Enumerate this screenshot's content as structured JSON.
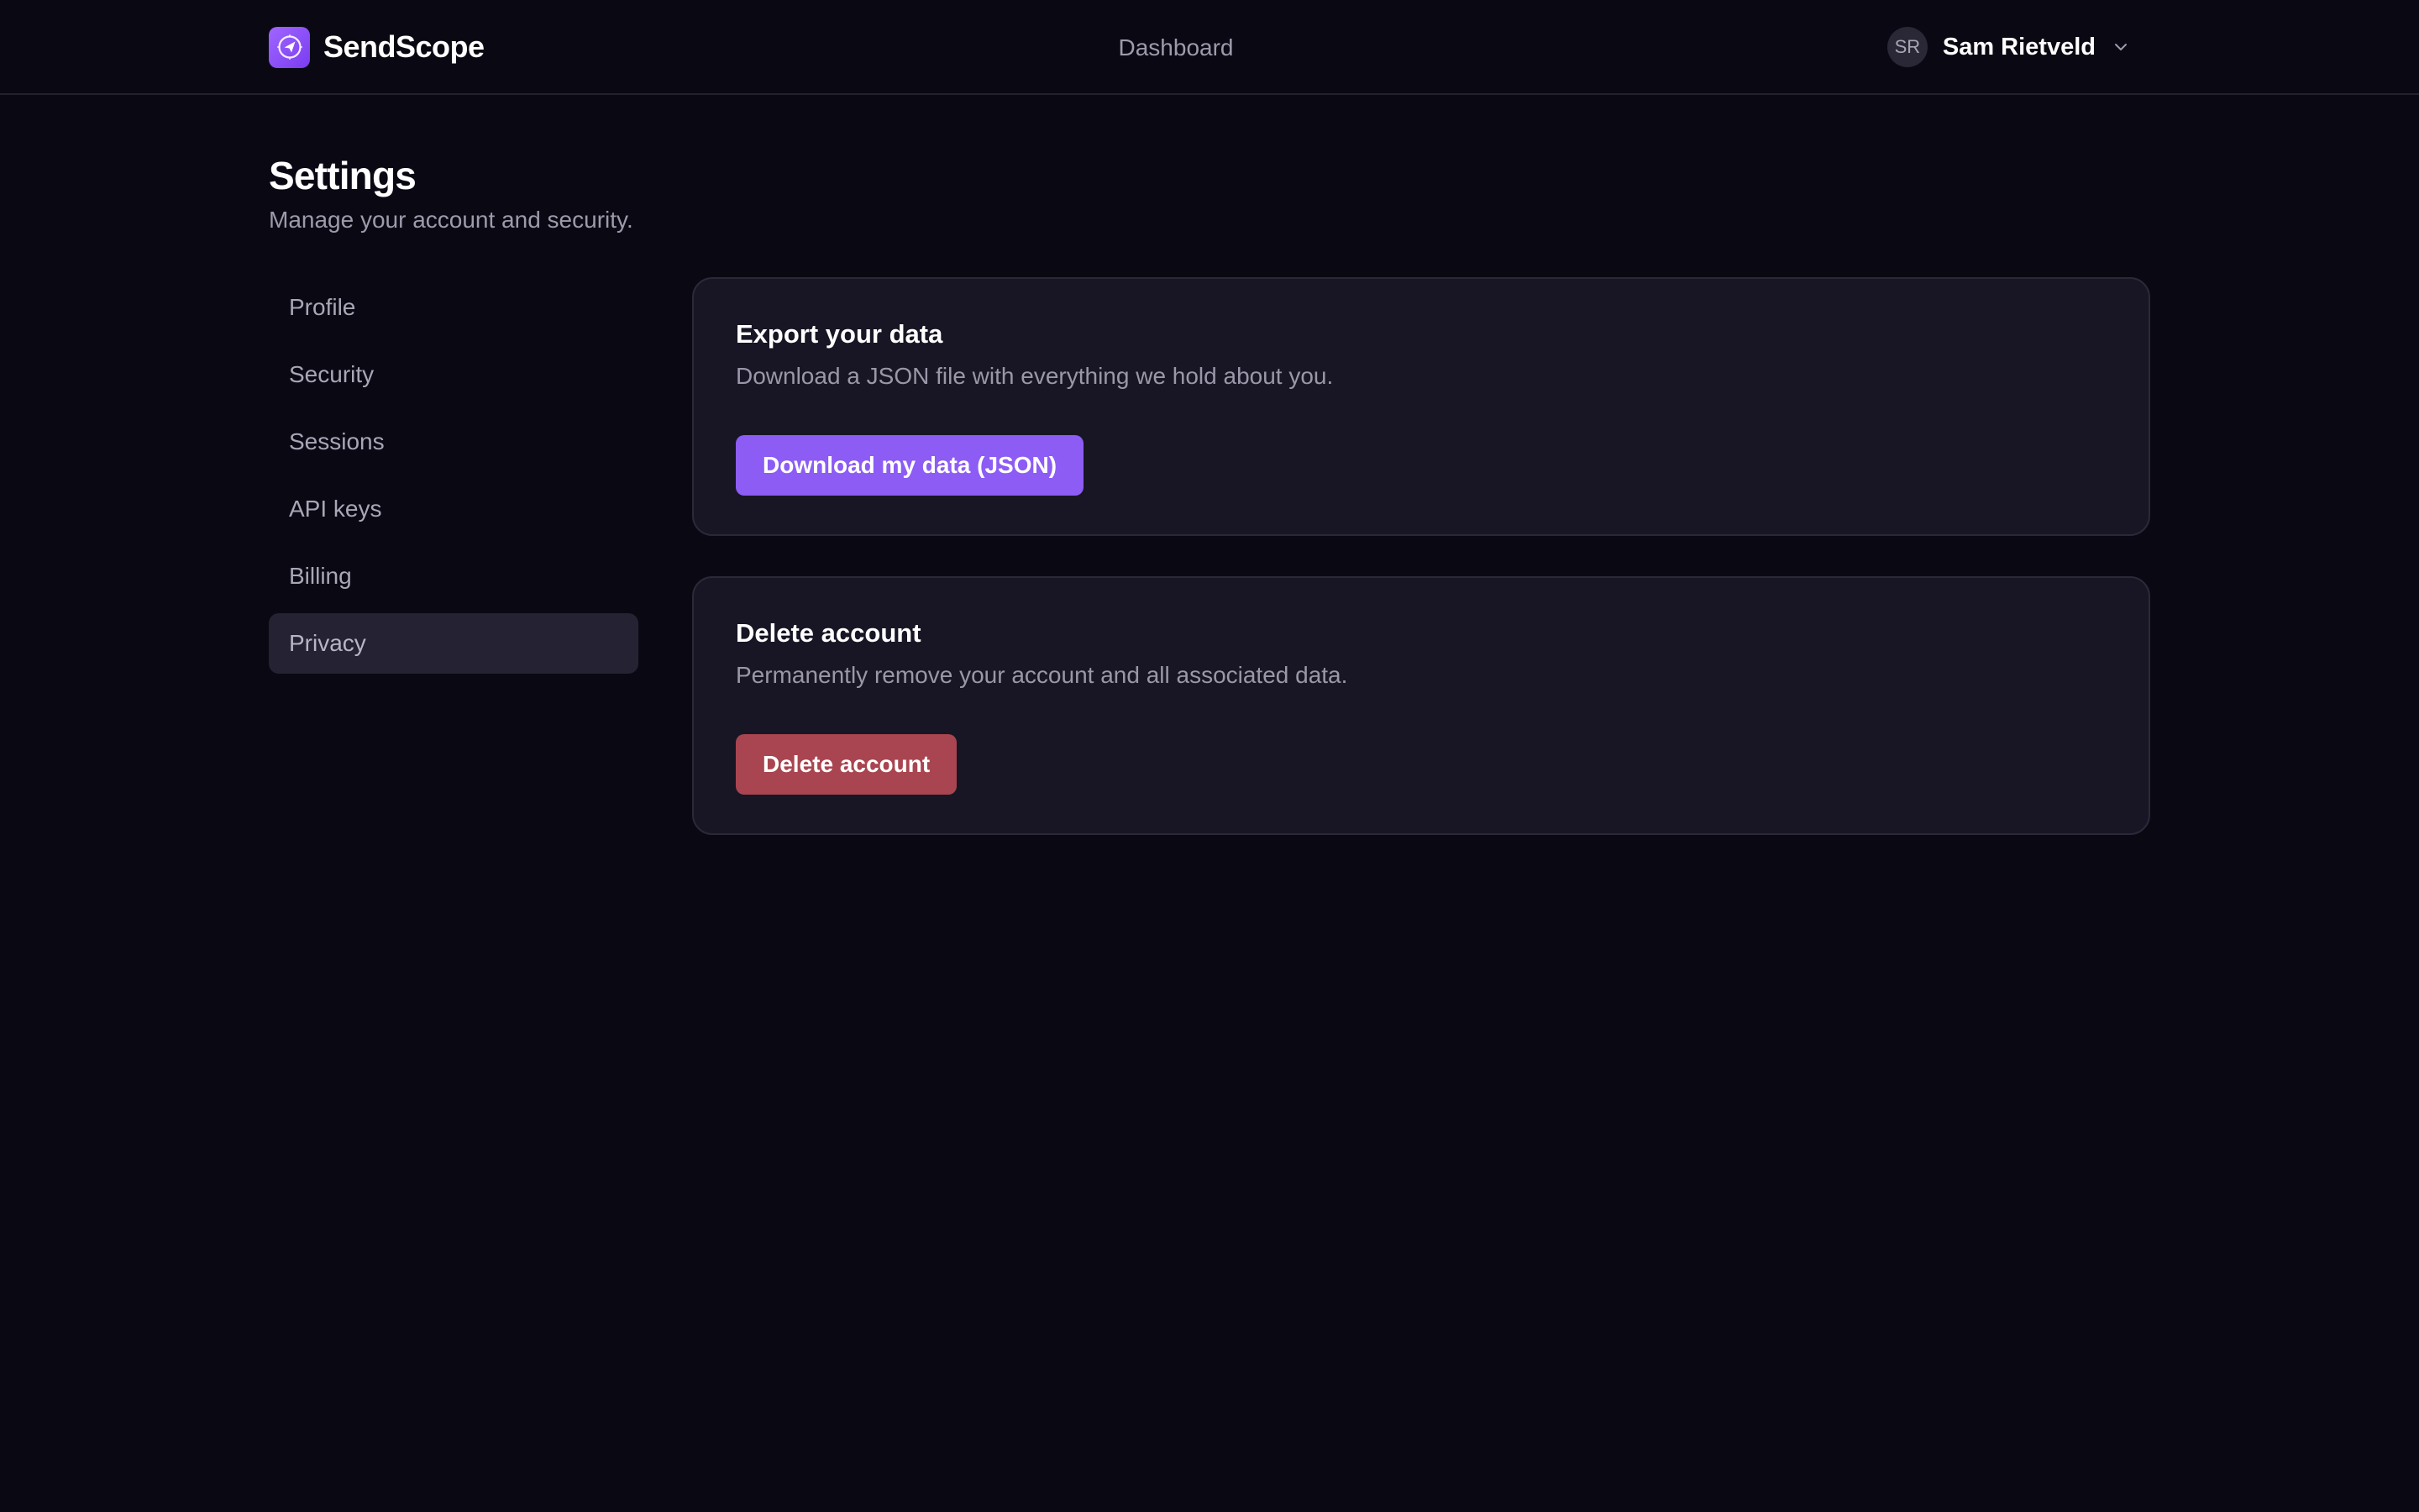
{
  "header": {
    "brand_name": "SendScope",
    "nav_link": "Dashboard",
    "user": {
      "initials": "SR",
      "name": "Sam Rietveld"
    }
  },
  "page": {
    "title": "Settings",
    "subtitle": "Manage your account and security."
  },
  "sidebar": {
    "items": [
      {
        "label": "Profile",
        "active": false
      },
      {
        "label": "Security",
        "active": false
      },
      {
        "label": "Sessions",
        "active": false
      },
      {
        "label": "API keys",
        "active": false
      },
      {
        "label": "Billing",
        "active": false
      },
      {
        "label": "Privacy",
        "active": true
      }
    ]
  },
  "cards": {
    "export": {
      "title": "Export your data",
      "description": "Download a JSON file with everything we hold about you.",
      "button_label": "Download my data (JSON)"
    },
    "delete": {
      "title": "Delete account",
      "description": "Permanently remove your account and all associated data.",
      "button_label": "Delete account"
    }
  },
  "colors": {
    "background": "#0a0913",
    "accent": "#8c5cf5",
    "danger": "#a94550",
    "card": "#181624",
    "sidebar_active": "#252333"
  },
  "icons": {
    "brand": "compass-send-icon",
    "user_menu": "chevron-down-icon"
  }
}
